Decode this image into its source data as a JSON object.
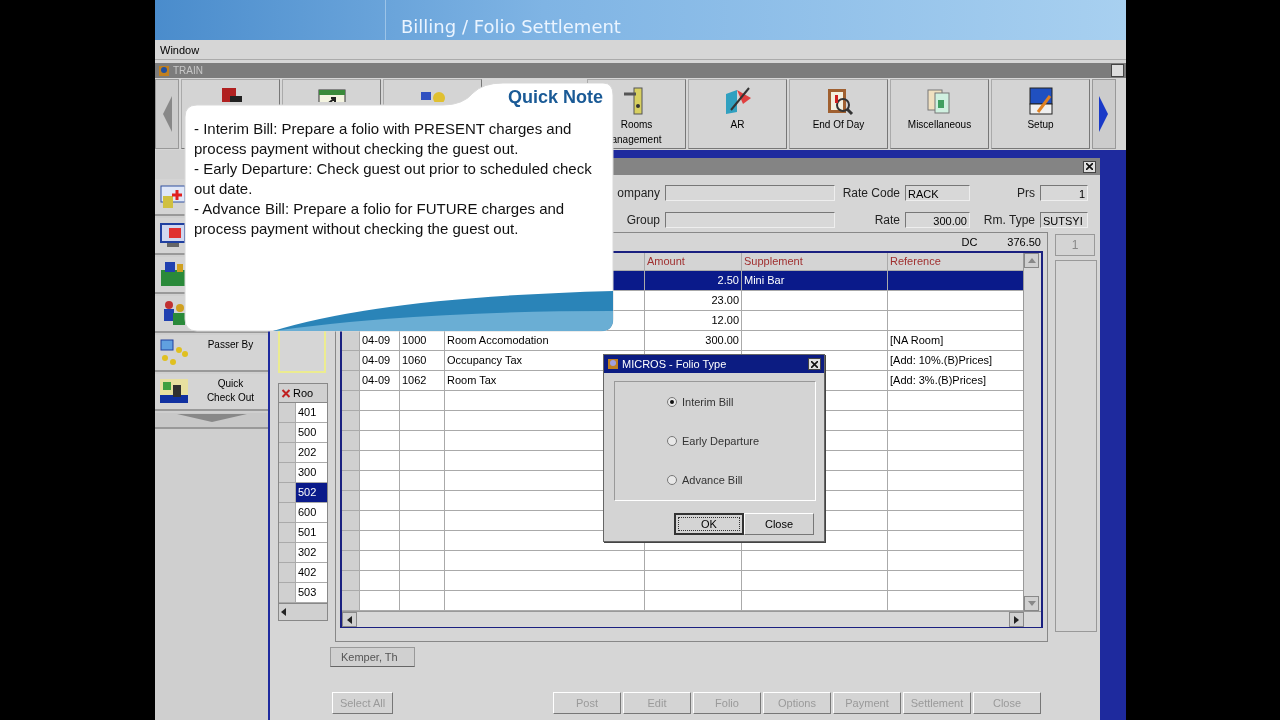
{
  "header": {
    "title": "Billing / Folio Settlement"
  },
  "menu": [
    "Window"
  ],
  "session": {
    "title": "TRAIN"
  },
  "toolbar": [
    {
      "kind": "exit"
    },
    {
      "kind": "calendar"
    },
    {
      "kind": "cards"
    },
    {
      "kind": "key",
      "lines": [
        "Rooms",
        "anagement"
      ]
    },
    {
      "kind": "ar",
      "lines": [
        "AR"
      ]
    },
    {
      "kind": "report",
      "lines": [
        "End Of Day"
      ]
    },
    {
      "kind": "papers",
      "lines": [
        "Miscellaneous"
      ]
    },
    {
      "kind": "setup",
      "lines": [
        "Setup"
      ]
    }
  ],
  "sidebar": [
    {
      "kind": "card"
    },
    {
      "kind": "screen"
    },
    {
      "kind": "luggage"
    },
    {
      "kind": "people"
    },
    {
      "kind": "group",
      "lines": [
        "Passer By"
      ]
    },
    {
      "kind": "checkout",
      "lines": [
        "Quick",
        "Check Out"
      ]
    }
  ],
  "form": [
    [
      {
        "label": "ompany"
      },
      {
        "label": "Group"
      }
    ],
    [
      {
        "label": "Rate Code",
        "value": "RACK"
      },
      {
        "label": "Rate",
        "value": "300.00",
        "kind": "number"
      }
    ],
    [
      {
        "label": "Prs",
        "value": "1",
        "kind": "number"
      },
      {
        "label": "Rm. Type",
        "value": "SUTSYI"
      }
    ]
  ],
  "totals": {
    "label": "DC",
    "value": "376.50"
  },
  "page_button": "1",
  "rooms": {
    "header": "Roo",
    "rows": [
      {
        "text": "401",
        "selected": false
      },
      {
        "text": "500",
        "selected": false
      },
      {
        "text": "202",
        "selected": false
      },
      {
        "text": "300",
        "selected": false
      },
      {
        "text": "502",
        "selected": true
      },
      {
        "text": "600",
        "selected": false
      },
      {
        "text": "501",
        "selected": false
      },
      {
        "text": "302",
        "selected": false
      },
      {
        "text": "402",
        "selected": false
      },
      {
        "text": "503",
        "selected": false
      }
    ]
  },
  "table": {
    "columns": [
      "Amount",
      "Supplement",
      "Reference"
    ],
    "rows": [
      {
        "selected": true,
        "amount": "2.50",
        "supplement": "Mini Bar"
      },
      {
        "selected": false,
        "amount": "23.00"
      },
      {
        "selected": false,
        "amount": "12.00"
      },
      {
        "selected": false,
        "column_2": "04-09",
        "column_3": "1000",
        "column_4": "Room Accomodation",
        "amount": "300.00",
        "reference": "[NA Room]"
      },
      {
        "selected": false,
        "column_2": "04-09",
        "column_3": "1060",
        "column_4": "Occupancy Tax",
        "reference": "[Add: 10%.(B)Prices]"
      },
      {
        "selected": false,
        "column_2": "04-09",
        "column_3": "1062",
        "column_4": "Room Tax",
        "reference": "[Add: 3%.(B)Prices]"
      }
    ]
  },
  "guest_tab": "Kemper, Th",
  "buttons": [
    {
      "label": "Select All",
      "disabled": true
    },
    {
      "label": "Post",
      "disabled": true
    },
    {
      "label": "Edit",
      "disabled": true
    },
    {
      "label": "Folio",
      "disabled": true
    },
    {
      "label": "Options",
      "disabled": true
    },
    {
      "label": "Payment",
      "disabled": true
    },
    {
      "label": "Settlement",
      "disabled": true
    },
    {
      "label": "Close",
      "disabled": true
    }
  ],
  "quick_note": {
    "title": "Quick Note",
    "paragraphs": [
      "- Interim Bill: Prepare a folio with PRESENT charges and process payment without checking the guest out.",
      "- Early Departure: Check guest out prior to scheduled check out date.",
      "- Advance Bill: Prepare a folio for FUTURE charges and process payment without checking the guest out."
    ]
  },
  "dialog": {
    "title": "MICROS - Folio Type",
    "options": [
      {
        "label": "Interim Bill",
        "selected": true
      },
      {
        "label": "Early Departure",
        "selected": false
      },
      {
        "label": "Advance Bill",
        "selected": false
      }
    ],
    "buttons": [
      {
        "label": "OK",
        "focused": true
      },
      {
        "label": "Close",
        "focused": false
      }
    ]
  }
}
